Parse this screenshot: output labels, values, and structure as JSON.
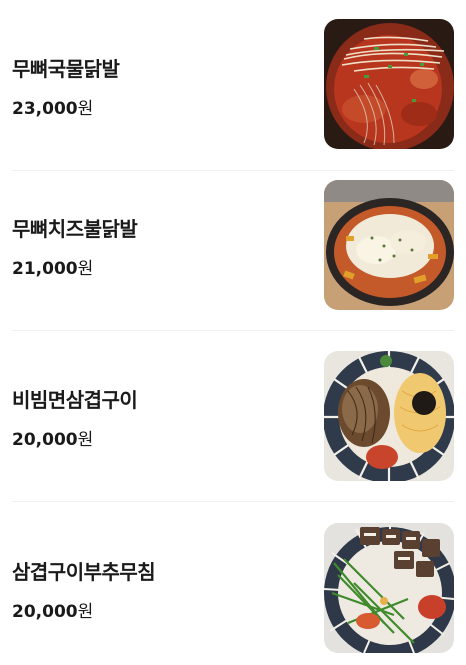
{
  "menu": {
    "items": [
      {
        "name": "무뼈국물닭발",
        "price": "23,000",
        "unit": "원",
        "image": "bowl-spicy-chicken-feet-soup-with-bean-sprouts"
      },
      {
        "name": "무뼈치즈불닭발",
        "price": "21,000",
        "unit": "원",
        "image": "cheese-topped-spicy-chicken-feet"
      },
      {
        "name": "비빔면삼겹구이",
        "price": "20,000",
        "unit": "원",
        "image": "bibim-noodles-with-grilled-pork-belly"
      },
      {
        "name": "삼겹구이부추무침",
        "price": "20,000",
        "unit": "원",
        "image": "grilled-pork-belly-with-chive-salad"
      }
    ]
  }
}
